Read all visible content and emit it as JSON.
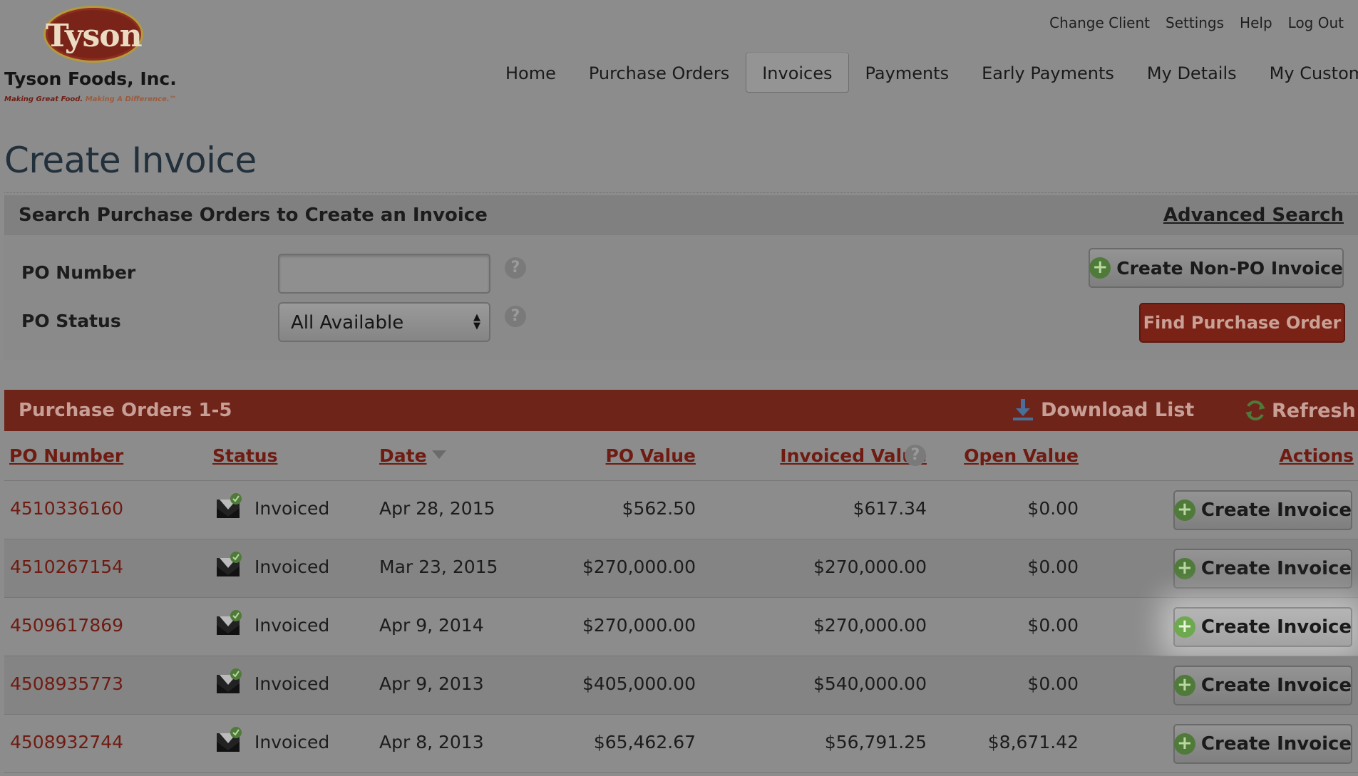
{
  "brand": {
    "logo_text": "Tyson",
    "company": "Tyson Foods, Inc.",
    "tagline_a": "Making Great Food.",
    "tagline_b": "Making A Difference.™"
  },
  "top_links": [
    "Change Client",
    "Settings",
    "Help",
    "Log Out"
  ],
  "nav": {
    "items": [
      "Home",
      "Purchase Orders",
      "Invoices",
      "Payments",
      "Early Payments",
      "My Details",
      "My Customer"
    ],
    "active": "Invoices"
  },
  "page": {
    "title": "Create Invoice"
  },
  "search": {
    "heading": "Search Purchase Orders to Create an Invoice",
    "advanced_link": "Advanced Search",
    "po_number_label": "PO Number",
    "po_number_value": "",
    "po_status_label": "PO Status",
    "po_status_value": "All Available",
    "help_glyph": "?",
    "non_po_button": "Create Non-PO Invoice",
    "find_button": "Find Purchase Order"
  },
  "results": {
    "title": "Purchase Orders 1-5",
    "download_label": "Download List",
    "refresh_label": "Refresh",
    "columns": [
      "PO Number",
      "Status",
      "Date",
      "PO Value",
      "Invoiced Value",
      "Open Value",
      "Actions"
    ],
    "sort_column": "Date",
    "sort_direction": "descending",
    "action_label": "Create Invoice",
    "rows": [
      {
        "po": "4510336160",
        "status": "Invoiced",
        "date": "Apr 28, 2015",
        "po_value": "$562.50",
        "invoiced": "$617.34",
        "open": "$0.00"
      },
      {
        "po": "4510267154",
        "status": "Invoiced",
        "date": "Mar 23, 2015",
        "po_value": "$270,000.00",
        "invoiced": "$270,000.00",
        "open": "$0.00"
      },
      {
        "po": "4509617869",
        "status": "Invoiced",
        "date": "Apr 9, 2014",
        "po_value": "$270,000.00",
        "invoiced": "$270,000.00",
        "open": "$0.00"
      },
      {
        "po": "4508935773",
        "status": "Invoiced",
        "date": "Apr 9, 2013",
        "po_value": "$405,000.00",
        "invoiced": "$540,000.00",
        "open": "$0.00"
      },
      {
        "po": "4508932744",
        "status": "Invoiced",
        "date": "Apr 8, 2013",
        "po_value": "$65,462.67",
        "invoiced": "$56,791.25",
        "open": "$8,671.42"
      }
    ],
    "highlighted_row": 3
  },
  "colors": {
    "brand_red": "#7a2216",
    "link_red": "#6f1b12",
    "accent_green": "#4f7a3a"
  }
}
